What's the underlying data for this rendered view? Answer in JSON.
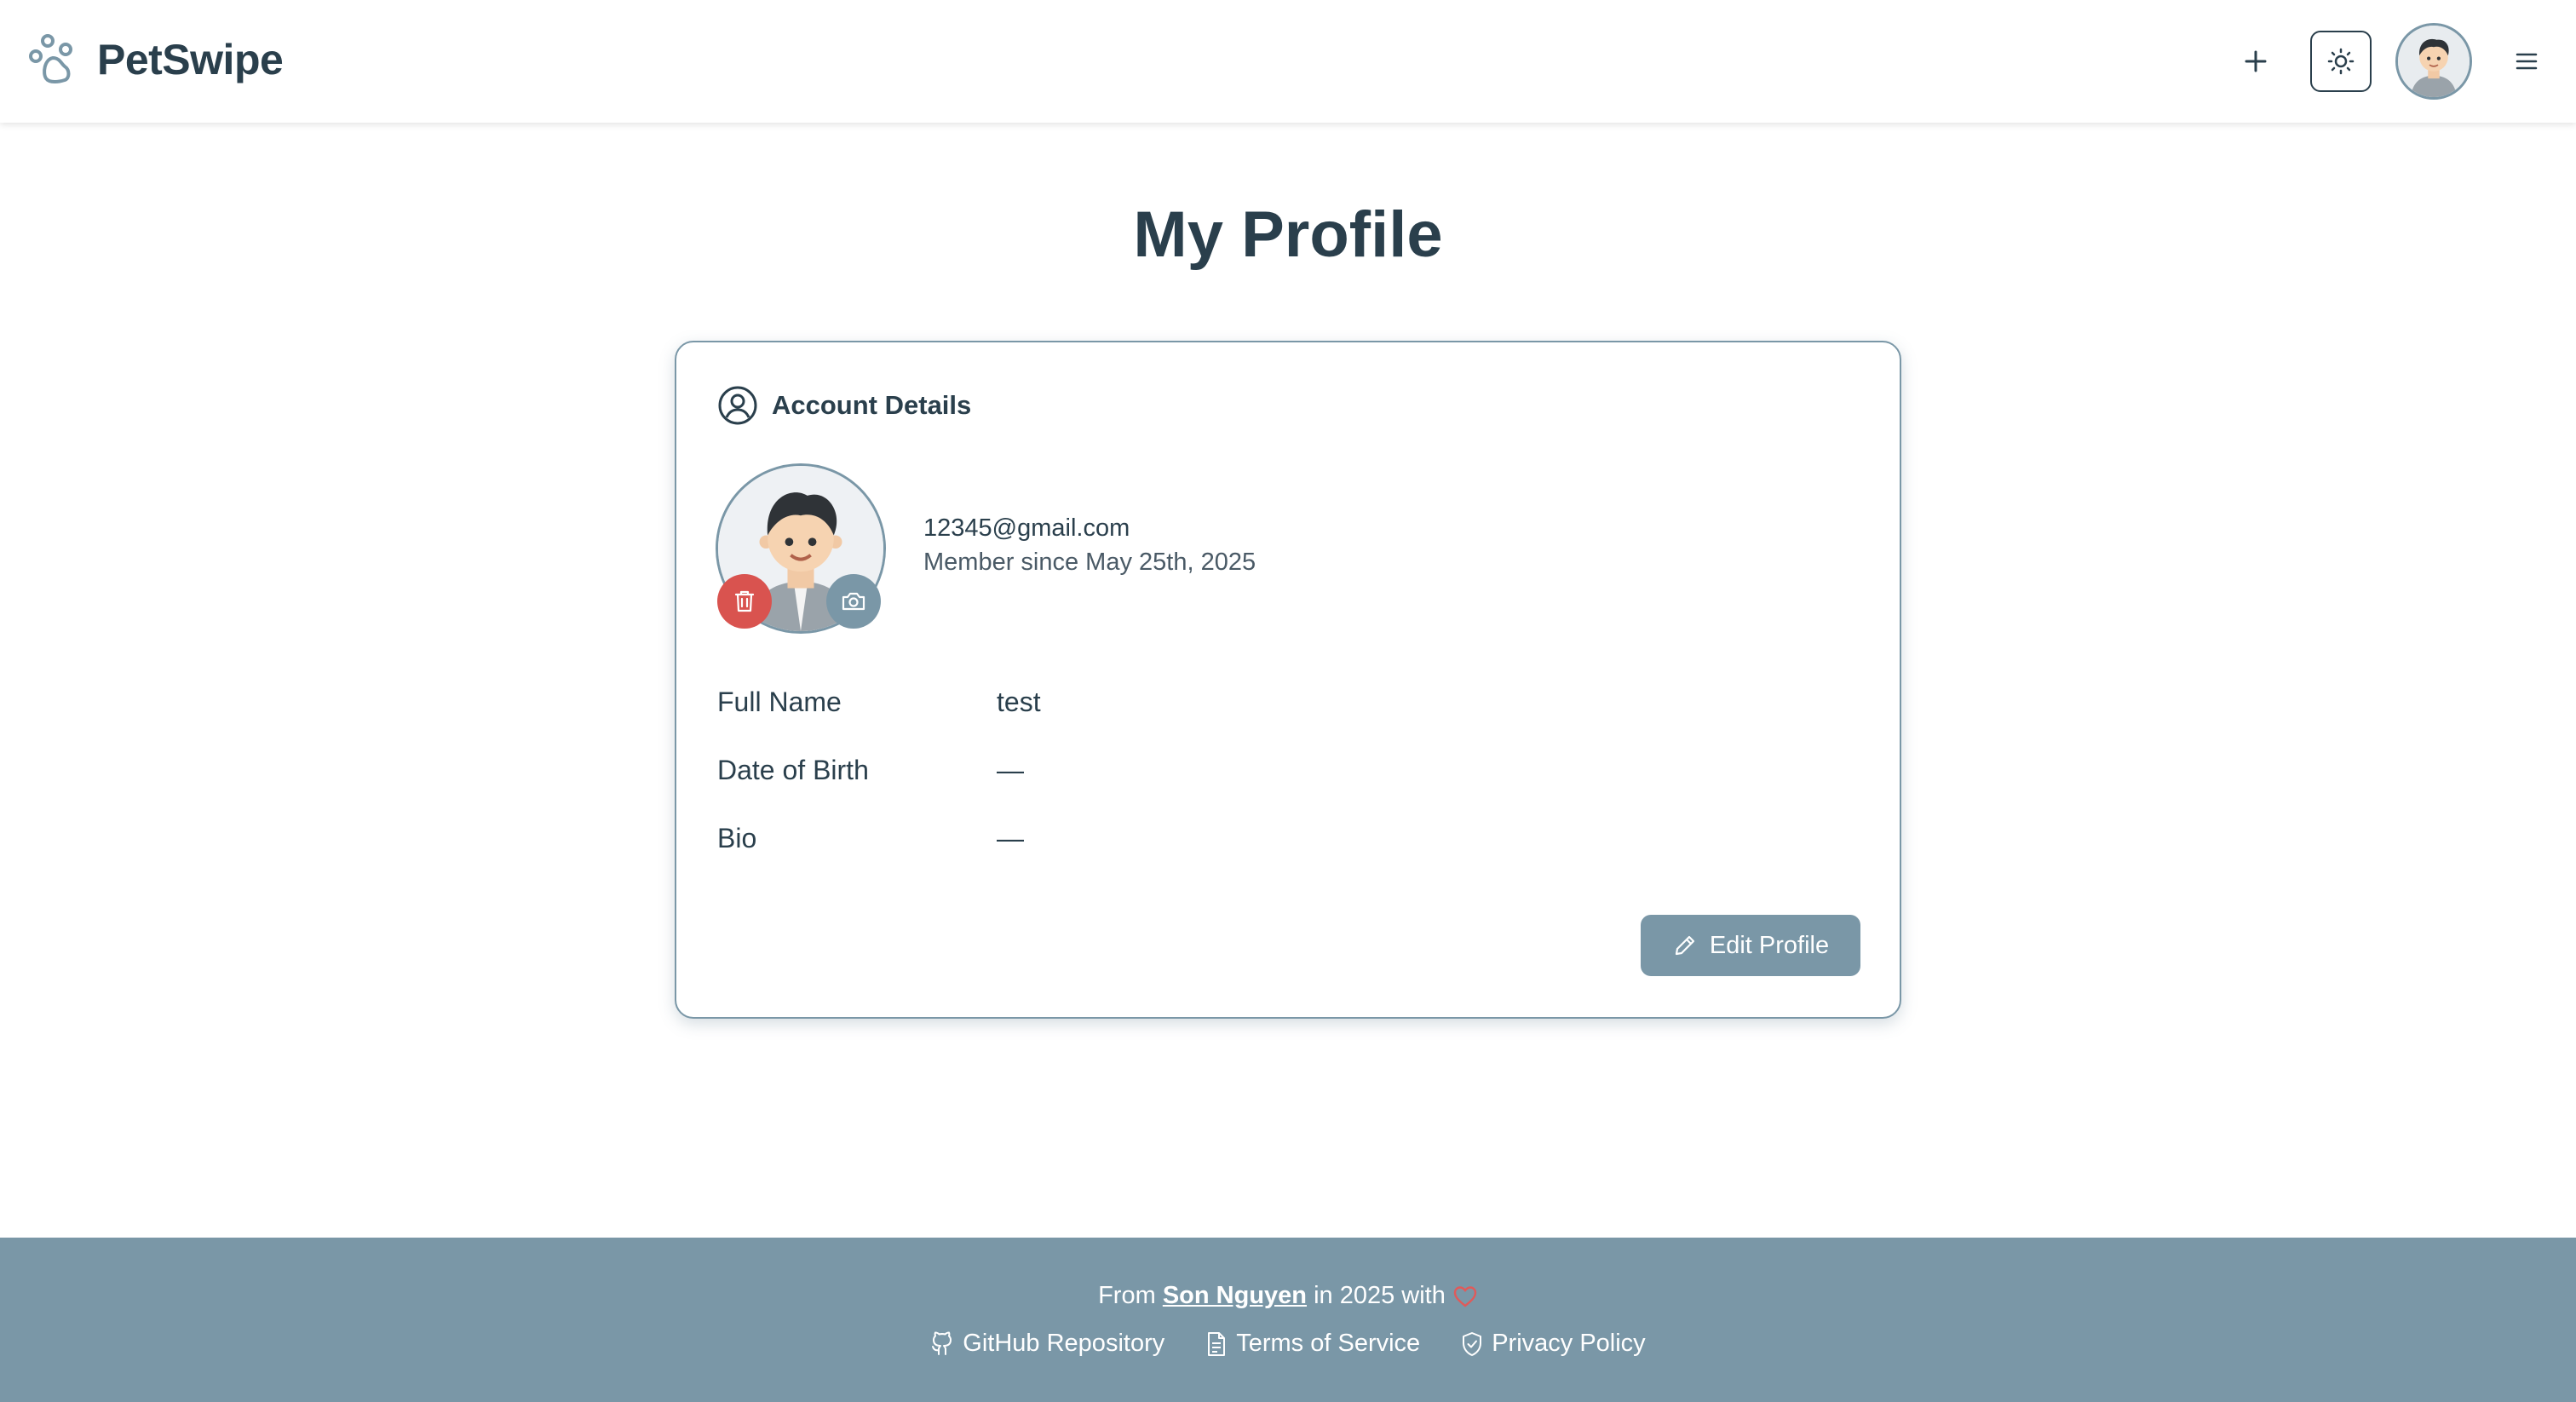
{
  "app": {
    "name": "PetSwipe"
  },
  "header": {
    "add_icon": "plus-icon",
    "theme_icon": "sun-icon",
    "menu_icon": "hamburger-icon"
  },
  "page": {
    "title": "My Profile"
  },
  "account": {
    "section_title": "Account Details",
    "email": "12345@gmail.com",
    "member_since": "Member since May 25th, 2025",
    "fields": [
      {
        "label": "Full Name",
        "value": "test"
      },
      {
        "label": "Date of Birth",
        "value": "—"
      },
      {
        "label": "Bio",
        "value": "—"
      }
    ],
    "edit_label": "Edit Profile"
  },
  "footer": {
    "prefix": "From",
    "author": "Son Nguyen",
    "suffix": "in 2025 with",
    "links": [
      {
        "label": "GitHub Repository",
        "icon": "github-icon"
      },
      {
        "label": "Terms of Service",
        "icon": "document-icon"
      },
      {
        "label": "Privacy Policy",
        "icon": "shield-check-icon"
      }
    ]
  },
  "colors": {
    "primary": "#7a97a7",
    "text": "#2a3f4c",
    "danger": "#d9534f",
    "heart": "#e05a5a"
  }
}
